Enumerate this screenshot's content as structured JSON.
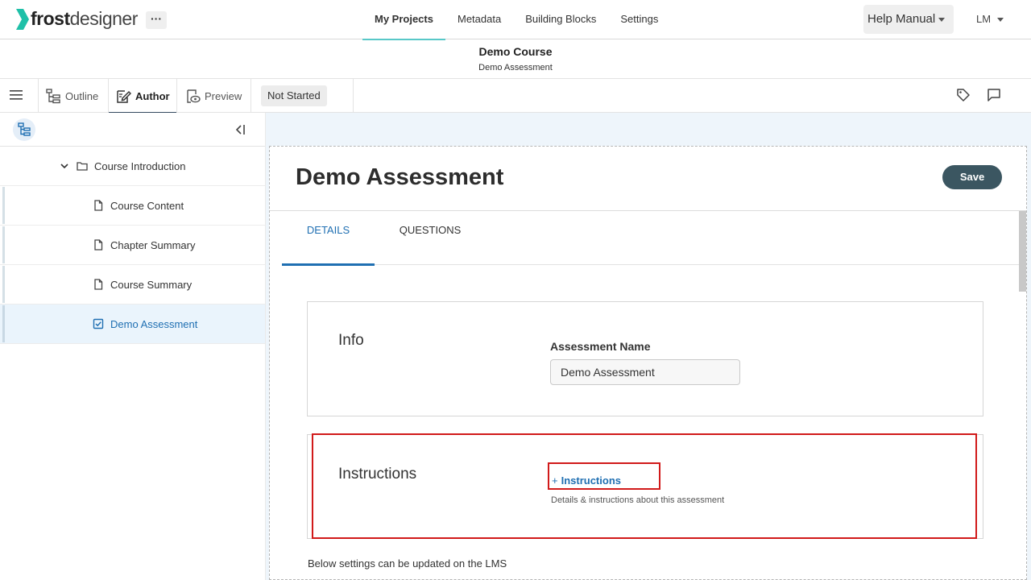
{
  "app": {
    "brand_bold": "frost",
    "brand_light": "designer",
    "more_label": "···"
  },
  "nav": {
    "items": [
      {
        "label": "My Projects",
        "active": true
      },
      {
        "label": "Metadata",
        "active": false
      },
      {
        "label": "Building Blocks",
        "active": false
      },
      {
        "label": "Settings",
        "active": false
      }
    ],
    "help_label": "Help Manual",
    "user_initials": "LM"
  },
  "course": {
    "title": "Demo Course",
    "subtitle": "Demo Assessment"
  },
  "toolbar": {
    "outline_label": "Outline",
    "author_label": "Author",
    "preview_label": "Preview",
    "status_label": "Not Started",
    "right_icons": [
      "tag-icon",
      "comment-icon"
    ]
  },
  "sidebar": {
    "tree": [
      {
        "label": "Course Introduction",
        "type": "folder",
        "expanded": true
      },
      {
        "label": "Course Content",
        "type": "page"
      },
      {
        "label": "Chapter Summary",
        "type": "page"
      },
      {
        "label": "Course Summary",
        "type": "page"
      },
      {
        "label": "Demo Assessment",
        "type": "assessment",
        "selected": true
      }
    ]
  },
  "editor": {
    "title": "Demo Assessment",
    "save_label": "Save",
    "tabs": [
      {
        "label": "DETAILS",
        "active": true
      },
      {
        "label": "QUESTIONS",
        "active": false
      }
    ],
    "info": {
      "section_label": "Info",
      "name_label": "Assessment Name",
      "name_value": "Demo Assessment"
    },
    "instructions": {
      "section_label": "Instructions",
      "add_label": "Instructions",
      "add_prefix": "+",
      "help_text": "Details & instructions about this assessment"
    },
    "footer_note": "Below settings can be updated on the LMS"
  },
  "colors": {
    "accent": "#1f6fb2",
    "brand_teal": "#1fc0a8",
    "save_bg": "#3b5661",
    "highlight": "#d11a1a",
    "main_bg": "#eef5fb"
  }
}
